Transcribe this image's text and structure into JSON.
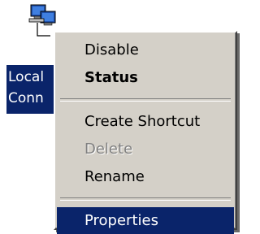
{
  "desktop": {
    "icon_name": "network-connection-icon",
    "label_lines": [
      "Local",
      "Conn"
    ]
  },
  "context_menu": {
    "items": [
      {
        "label": "Disable",
        "state": "normal"
      },
      {
        "label": "Status",
        "state": "default-bold"
      },
      {
        "label": "Create Shortcut",
        "state": "normal"
      },
      {
        "label": "Delete",
        "state": "disabled"
      },
      {
        "label": "Rename",
        "state": "normal"
      },
      {
        "label": "Properties",
        "state": "selected"
      }
    ]
  },
  "colors": {
    "menu_background": "#d4d0c8",
    "selection": "#0a246a",
    "selection_text": "#ffffff",
    "disabled_text": "#808080"
  }
}
